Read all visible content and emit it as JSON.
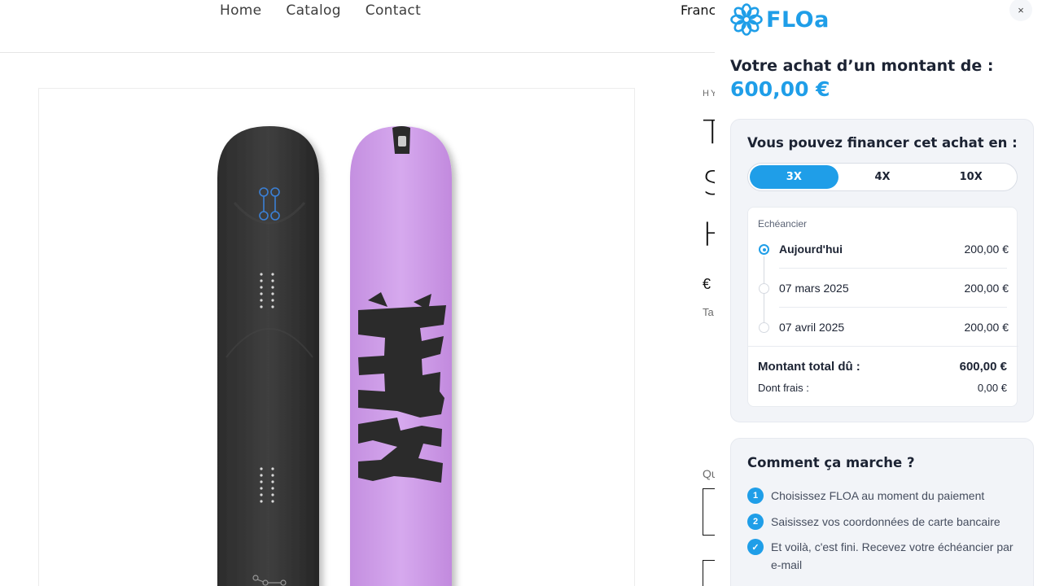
{
  "store": {
    "nav": [
      "Home",
      "Catalog",
      "Contact"
    ],
    "country": "Franc",
    "product": {
      "vendor": "HY",
      "title_fragment": "T S H",
      "price_fragment": "€",
      "tax_fragment": "Ta",
      "quantity_fragment": "Qu"
    }
  },
  "floa": {
    "brand": "FLOa",
    "close_label": "×",
    "purchase_title": "Votre achat d’un montant de :",
    "purchase_amount": "600,00 €",
    "finance": {
      "title": "Vous pouvez financer cet achat en :",
      "tabs": [
        {
          "label": "3X",
          "active": true
        },
        {
          "label": "4X",
          "active": false
        },
        {
          "label": "10X",
          "active": false
        }
      ],
      "schedule_label": "Echéancier",
      "schedule": [
        {
          "date": "Aujourd'hui",
          "amount": "200,00 €"
        },
        {
          "date": "07 mars 2025",
          "amount": "200,00 €"
        },
        {
          "date": "07 avril 2025",
          "amount": "200,00 €"
        }
      ],
      "total_label": "Montant total dû :",
      "total_value": "600,00 €",
      "fees_label": "Dont frais :",
      "fees_value": "0,00 €"
    },
    "how": {
      "title": "Comment ça marche ?",
      "steps": [
        {
          "marker": "1",
          "text": "Choisissez FLOA au moment du paiement"
        },
        {
          "marker": "2",
          "text": "Saisissez vos coordonnées de carte bancaire"
        },
        {
          "marker": "✓",
          "text": "Et voilà, c'est fini. Recevez votre échéancier par e-mail"
        }
      ]
    },
    "accent_color": "#1f9ee8"
  }
}
